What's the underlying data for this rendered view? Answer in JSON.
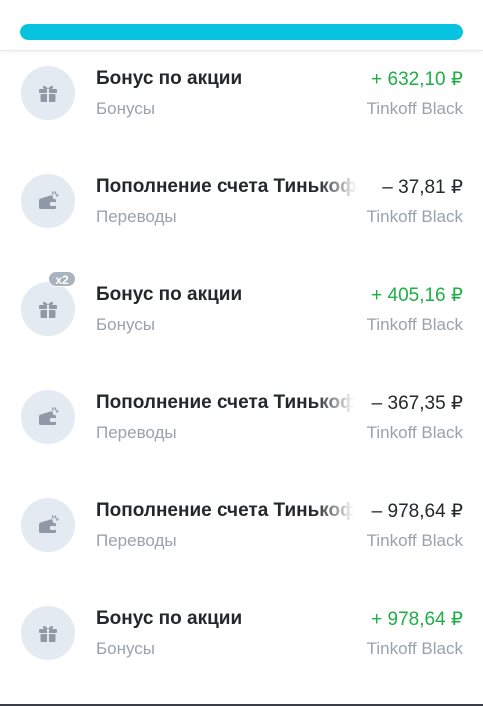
{
  "colors": {
    "progress_fill": "#07c3e0",
    "income": "#1eaf46",
    "icon": "#8f9aa6"
  },
  "progress_percent": 100,
  "operations": [
    {
      "title": "Бонус по акции",
      "category": "Бонусы",
      "amount": "+ 632,10 ₽",
      "account": "Tinkoff Black",
      "icon": "gift-icon"
    },
    {
      "title": "Пополнение счета Тинькоф",
      "category": "Переводы",
      "amount": "– 37,81 ₽",
      "account": "Tinkoff Black",
      "icon": "wallet-icon"
    },
    {
      "title": "Бонус по акции",
      "category": "Бонусы",
      "amount": "+ 405,16 ₽",
      "account": "Tinkoff Black",
      "icon": "gift-icon",
      "badge": "x2"
    },
    {
      "title": "Пополнение счета Тинькоф",
      "category": "Переводы",
      "amount": "– 367,35 ₽",
      "account": "Tinkoff Black",
      "icon": "wallet-icon"
    },
    {
      "title": "Пополнение счета Тинькоф",
      "category": "Переводы",
      "amount": "– 978,64 ₽",
      "account": "Tinkoff Black",
      "icon": "wallet-icon"
    },
    {
      "title": "Бонус по акции",
      "category": "Бонусы",
      "amount": "+ 978,64 ₽",
      "account": "Tinkoff Black",
      "icon": "gift-icon"
    }
  ]
}
